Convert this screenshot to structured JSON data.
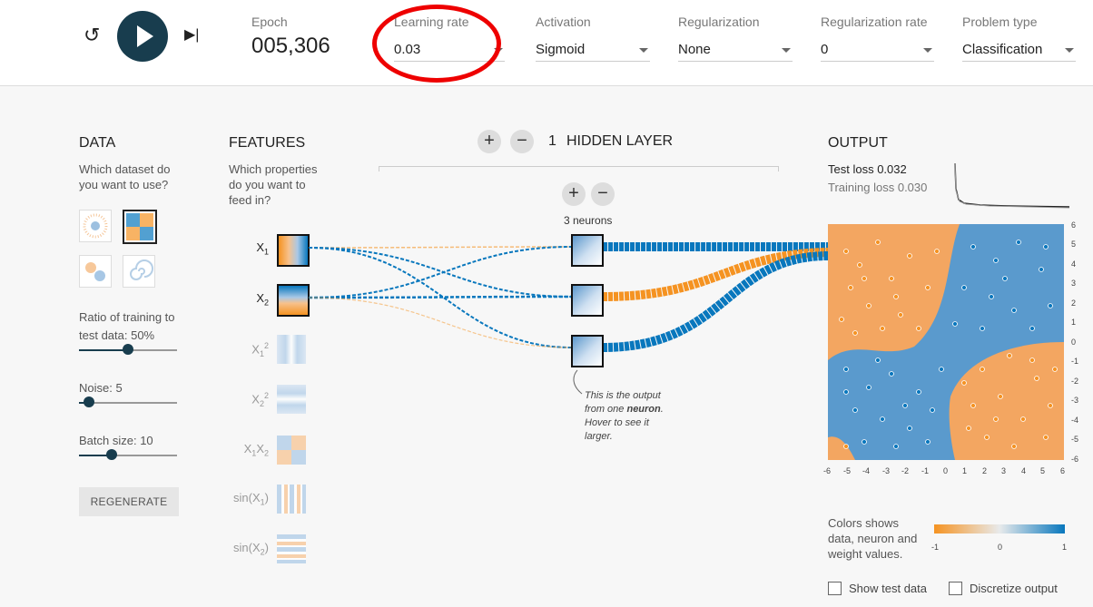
{
  "controls": {
    "epoch_label": "Epoch",
    "epoch_value": "005,306",
    "learning_rate": {
      "label": "Learning rate",
      "value": "0.03"
    },
    "activation": {
      "label": "Activation",
      "value": "Sigmoid"
    },
    "regularization": {
      "label": "Regularization",
      "value": "None"
    },
    "regularization_rate": {
      "label": "Regularization rate",
      "value": "0"
    },
    "problem_type": {
      "label": "Problem type",
      "value": "Classification"
    }
  },
  "data_panel": {
    "title": "DATA",
    "subtitle_line1": "Which dataset do",
    "subtitle_line2": "you want to use?",
    "ratio_label_line1": "Ratio of training to",
    "ratio_label_line2": "test data:  50%",
    "ratio_value": 0.5,
    "noise_label": "Noise:  5",
    "noise_value": 0.1,
    "batch_label": "Batch size:  10",
    "batch_value": 0.33,
    "regenerate": "REGENERATE"
  },
  "features_panel": {
    "title": "FEATURES",
    "sub1": "Which properties",
    "sub2": "do you want to",
    "sub3": "feed in?",
    "items": [
      {
        "base": "X",
        "sub": "1",
        "sup": "",
        "active": true
      },
      {
        "base": "X",
        "sub": "2",
        "sup": "",
        "active": true
      },
      {
        "base": "X",
        "sub": "1",
        "sup": "2",
        "active": false
      },
      {
        "base": "X",
        "sub": "2",
        "sup": "2",
        "active": false
      },
      {
        "base": "X",
        "sub": "1",
        "base2": "X",
        "sub2": "2",
        "active": false
      },
      {
        "base": "sin(X",
        "sub": "1",
        "tail": ")",
        "active": false
      },
      {
        "base": "sin(X",
        "sub": "2",
        "tail": ")",
        "active": false
      }
    ]
  },
  "network": {
    "layers_count": "1",
    "layers_label": "HIDDEN LAYER",
    "neurons_label": "3 neurons",
    "note_1": "This is the output",
    "note_2a": "from one ",
    "note_2b": "neuron",
    "note_2c": ".",
    "note_3": "Hover to see it",
    "note_4": "larger."
  },
  "output_panel": {
    "title": "OUTPUT",
    "test_loss_label": "Test loss",
    "test_loss_value": "0.032",
    "training_loss_label": "Training loss",
    "training_loss_value": "0.030",
    "y_ticks": [
      "6",
      "5",
      "4",
      "3",
      "2",
      "1",
      "0",
      "-1",
      "-2",
      "-3",
      "-4",
      "-5",
      "-6"
    ],
    "x_ticks": [
      "-6",
      "-5",
      "-4",
      "-3",
      "-2",
      "-1",
      "0",
      "1",
      "2",
      "3",
      "4",
      "5",
      "6"
    ],
    "legend_text_1": "Colors shows",
    "legend_text_2": "data, neuron and",
    "legend_text_3": "weight values.",
    "legend_min": "-1",
    "legend_mid": "0",
    "legend_max": "1",
    "show_test": "Show test data",
    "discretize": "Discretize output"
  },
  "colors": {
    "orange": "#f59322",
    "blue": "#0877bd",
    "dark": "#183d4e",
    "annotation": "#e00000"
  }
}
